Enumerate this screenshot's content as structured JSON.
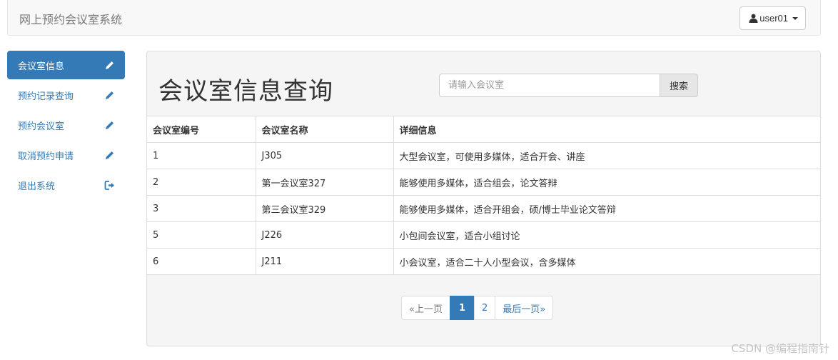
{
  "header": {
    "brand": "网上预约会议室系统",
    "user_label": "user01"
  },
  "sidebar": {
    "items": [
      {
        "label": "会议室信息",
        "icon": "pencil-icon",
        "active": true
      },
      {
        "label": "预约记录查询",
        "icon": "pencil-icon"
      },
      {
        "label": "预约会议室",
        "icon": "pencil-icon"
      },
      {
        "label": "取消预约申请",
        "icon": "pencil-icon"
      },
      {
        "label": "退出系统",
        "icon": "log-out-icon"
      }
    ]
  },
  "main": {
    "title": "会议室信息查询",
    "search": {
      "placeholder": "请输入会议室",
      "value": "",
      "button_label": "搜索"
    },
    "table": {
      "headers": [
        "会议室编号",
        "会议室名称",
        "详细信息"
      ],
      "rows": [
        [
          "1",
          "J305",
          "大型会议室，可使用多媒体，适合开会、讲座"
        ],
        [
          "2",
          "第一会议室327",
          "能够使用多媒体，适合组会，论文答辩"
        ],
        [
          "3",
          "第三会议室329",
          "能够使用多媒体，适合开组会，硕/博士毕业论文答辩"
        ],
        [
          "5",
          "J226",
          "小包间会议室，适合小组讨论"
        ],
        [
          "6",
          "J211",
          "小会议室，适合二十人小型会议，含多媒体"
        ]
      ]
    },
    "pagination": {
      "prev": "«上一页",
      "pages": [
        "1",
        "2"
      ],
      "current": "1",
      "last": "最后一页»"
    }
  },
  "watermark": "CSDN @编程指南针",
  "colors": {
    "primary": "#337ab7",
    "navbar_bg": "#f8f8f8",
    "panel_bg": "#f5f5f5",
    "border": "#dddddd"
  }
}
